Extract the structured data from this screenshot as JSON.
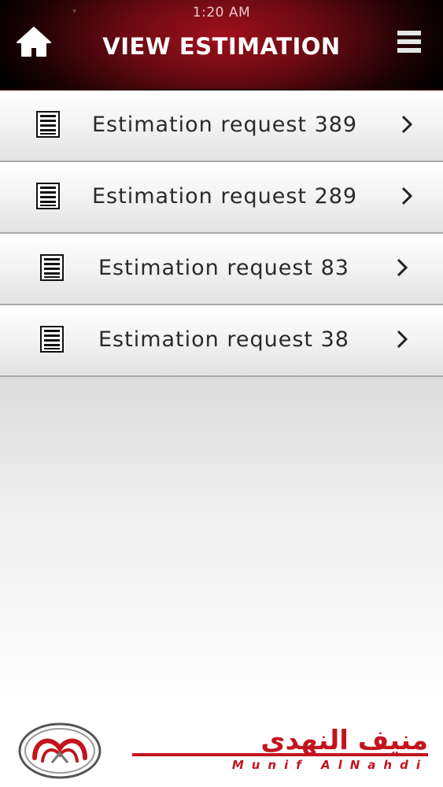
{
  "status_bar": {
    "time": "1:20 AM"
  },
  "header": {
    "title": "VIEW ESTIMATION",
    "home_icon": "home-icon",
    "menu_icon": "hamburger-menu-icon"
  },
  "requests": [
    {
      "label": "Estimation request 389"
    },
    {
      "label": "Estimation request 289"
    },
    {
      "label": "Estimation request 83"
    },
    {
      "label": "Estimation request 38"
    }
  ],
  "footer": {
    "brand_arabic": "منيف النهدي",
    "brand_latin": "Munif AlNahdi",
    "accent_color": "#c3141e"
  }
}
